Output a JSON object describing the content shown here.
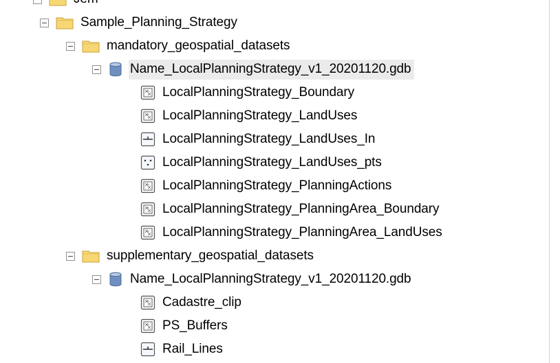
{
  "tree": {
    "top_partial": {
      "label": "Jem",
      "icon": "folder-icon"
    },
    "root": {
      "label": "Sample_Planning_Strategy",
      "icon": "folder-icon",
      "folders": [
        {
          "label": "mandatory_geospatial_datasets",
          "icon": "folder-icon",
          "gdb": {
            "label": "Name_LocalPlanningStrategy_v1_20201120.gdb",
            "icon": "geodatabase-icon",
            "items": [
              {
                "label": "LocalPlanningStrategy_Boundary",
                "icon": "polygon-feature-class-icon"
              },
              {
                "label": "LocalPlanningStrategy_LandUses",
                "icon": "polygon-feature-class-icon"
              },
              {
                "label": "LocalPlanningStrategy_LandUses_In",
                "icon": "line-feature-class-icon"
              },
              {
                "label": "LocalPlanningStrategy_LandUses_pts",
                "icon": "point-feature-class-icon"
              },
              {
                "label": "LocalPlanningStrategy_PlanningActions",
                "icon": "polygon-feature-class-icon"
              },
              {
                "label": "LocalPlanningStrategy_PlanningArea_Boundary",
                "icon": "polygon-feature-class-icon"
              },
              {
                "label": "LocalPlanningStrategy_PlanningArea_LandUses",
                "icon": "polygon-feature-class-icon"
              }
            ]
          }
        },
        {
          "label": "supplementary_geospatial_datasets",
          "icon": "folder-icon",
          "gdb": {
            "label": "Name_LocalPlanningStrategy_v1_20201120.gdb",
            "icon": "geodatabase-icon",
            "items": [
              {
                "label": "Cadastre_clip",
                "icon": "polygon-feature-class-icon"
              },
              {
                "label": "PS_Buffers",
                "icon": "polygon-feature-class-icon"
              },
              {
                "label": "Rail_Lines",
                "icon": "line-feature-class-icon"
              }
            ]
          }
        }
      ]
    },
    "colors": {
      "folder_fill": "#f7d774",
      "folder_edge": "#c9a13a",
      "db_fill": "#6f8fbf",
      "selection_bg": "#ebebeb"
    }
  }
}
